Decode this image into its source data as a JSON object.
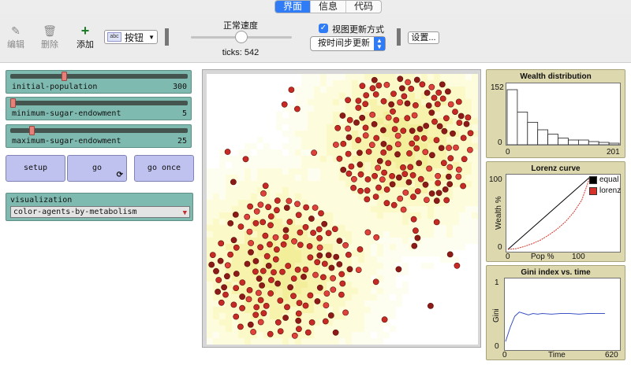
{
  "tabs": [
    {
      "label": "界面",
      "active": true
    },
    {
      "label": "信息",
      "active": false
    },
    {
      "label": "代码",
      "active": false
    }
  ],
  "toolbar": {
    "edit_label": "编辑",
    "delete_label": "删除",
    "add_label": "添加",
    "widget_type": "按钮",
    "widget_icon_text": "abc",
    "speed_label": "正常速度",
    "speed_fraction": 0.5,
    "ticks_label": "ticks: 542",
    "view_updates_label": "视图更新方式",
    "view_updates_checked": true,
    "update_mode": "按时间步更新",
    "settings_label": "设置..."
  },
  "sliders": [
    {
      "label": "initial-population",
      "value": "300",
      "fraction": 0.3
    },
    {
      "label": "minimum-sugar-endowment",
      "value": "5",
      "fraction": 0.0
    },
    {
      "label": "maximum-sugar-endowment",
      "value": "25",
      "fraction": 0.11
    }
  ],
  "buttons": {
    "setup": "setup",
    "go": "go",
    "go_once": "go once"
  },
  "chooser": {
    "label": "visualization",
    "value": "color-agents-by-metabolism"
  },
  "plots": {
    "wealth": {
      "title": "Wealth distribution",
      "ymax": "152",
      "ymin": "0",
      "xmin": "0",
      "xmax": "201"
    },
    "lorenz": {
      "title": "Lorenz curve",
      "ymax": "100",
      "ymin": "0",
      "xmin": "0",
      "xmax": "100",
      "xlabel": "Pop %",
      "ylabel": "Wealth %",
      "legend_equal": "equal",
      "legend_lorenz": "lorenz"
    },
    "gini": {
      "title": "Gini index vs. time",
      "ymax": "1",
      "ymin": "0",
      "xmin": "0",
      "xmax": "620",
      "xlabel": "Time",
      "ylabel": "Gini"
    }
  },
  "chart_data": [
    {
      "type": "bar",
      "title": "Wealth distribution",
      "values": [
        140,
        83,
        57,
        38,
        27,
        17,
        12,
        12,
        8,
        6,
        4
      ],
      "ylim": [
        0,
        152
      ],
      "xlim": [
        0,
        201
      ]
    },
    {
      "type": "line",
      "title": "Lorenz curve",
      "xlabel": "Pop %",
      "ylabel": "Wealth %",
      "series": [
        {
          "name": "equal",
          "x": [
            0,
            100
          ],
          "y": [
            0,
            100
          ],
          "color": "#000000"
        },
        {
          "name": "lorenz",
          "x": [
            0,
            10,
            20,
            30,
            40,
            50,
            60,
            70,
            80,
            90,
            100
          ],
          "y": [
            0,
            1,
            4,
            8,
            13,
            20,
            28,
            38,
            51,
            68,
            100
          ],
          "color": "#d73229"
        }
      ],
      "legend": "top-right"
    },
    {
      "type": "line",
      "title": "Gini index vs. time",
      "xlabel": "Time",
      "ylabel": "Gini",
      "series": [
        {
          "x": [
            0,
            25,
            50,
            75,
            100,
            125,
            150,
            175,
            200,
            250,
            300,
            350,
            400,
            450,
            500,
            542
          ],
          "y": [
            0.1,
            0.3,
            0.46,
            0.52,
            0.5,
            0.48,
            0.5,
            0.49,
            0.5,
            0.49,
            0.5,
            0.5,
            0.49,
            0.5,
            0.5,
            0.5
          ],
          "color": "#3b52c4"
        }
      ],
      "xlim": [
        0,
        620
      ],
      "ylim": [
        0,
        1
      ]
    }
  ],
  "colors": {
    "agent_fill": "#c72a24",
    "agent_dark": "#6e1513",
    "sugar_light": "#fdfde4",
    "sugar_dark": "#f6f3a8",
    "slider_bg": "#7fbab0",
    "button_bg": "#bfc1ee",
    "plot_bg": "#ddd8ad"
  }
}
